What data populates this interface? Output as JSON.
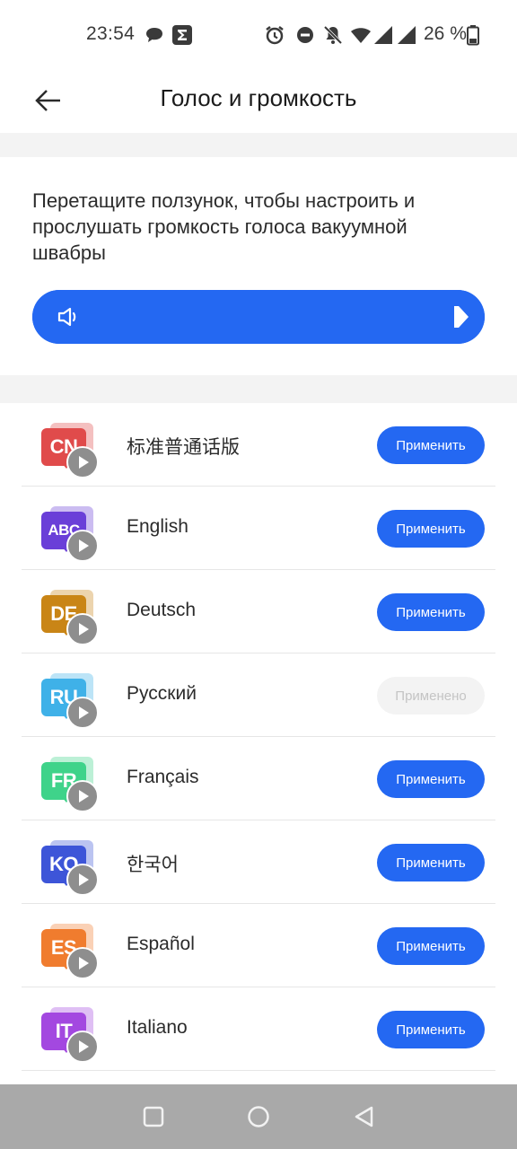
{
  "status_bar": {
    "time": "23:54",
    "battery_text": "26 %",
    "icons": [
      "chat-bubble-icon",
      "sigma-app-icon",
      "alarm-icon",
      "do-not-disturb-icon",
      "notifications-off-icon",
      "wifi-icon",
      "signal-icon",
      "signal-icon",
      "battery-icon"
    ]
  },
  "header": {
    "title": "Голос и громкость",
    "back_icon": "arrow-left-icon"
  },
  "volume": {
    "description": "Перетащите ползунок, чтобы настроить и прослушать громкость голоса вакуумной швабры",
    "level_fraction": 1.0,
    "icon": "speaker-icon"
  },
  "voices": [
    {
      "badge": "CN",
      "name": "标准普通话版",
      "button": "Применить",
      "applied": false,
      "color": "#e04b4b"
    },
    {
      "badge": "ABC",
      "name": "English",
      "button": "Применить",
      "applied": false,
      "color": "#6a3fd8"
    },
    {
      "badge": "DE",
      "name": "Deutsch",
      "button": "Применить",
      "applied": false,
      "color": "#c98516"
    },
    {
      "badge": "RU",
      "name": "Русский",
      "button": "Применено",
      "applied": true,
      "color": "#3fb1e8"
    },
    {
      "badge": "FR",
      "name": "Français",
      "button": "Применить",
      "applied": false,
      "color": "#3fd38a"
    },
    {
      "badge": "KO",
      "name": "한국어",
      "button": "Применить",
      "applied": false,
      "color": "#3d55d8"
    },
    {
      "badge": "ES",
      "name": "Español",
      "button": "Применить",
      "applied": false,
      "color": "#f07c2e"
    },
    {
      "badge": "IT",
      "name": "Italiano",
      "button": "Применить",
      "applied": false,
      "color": "#a348e0"
    }
  ],
  "colors": {
    "accent": "#2468f2",
    "applied_bg": "#f3f3f3",
    "nav_bar": "#a9a9a9"
  },
  "nav": {
    "icons": [
      "recent-apps-icon",
      "home-icon",
      "back-triangle-icon"
    ]
  }
}
